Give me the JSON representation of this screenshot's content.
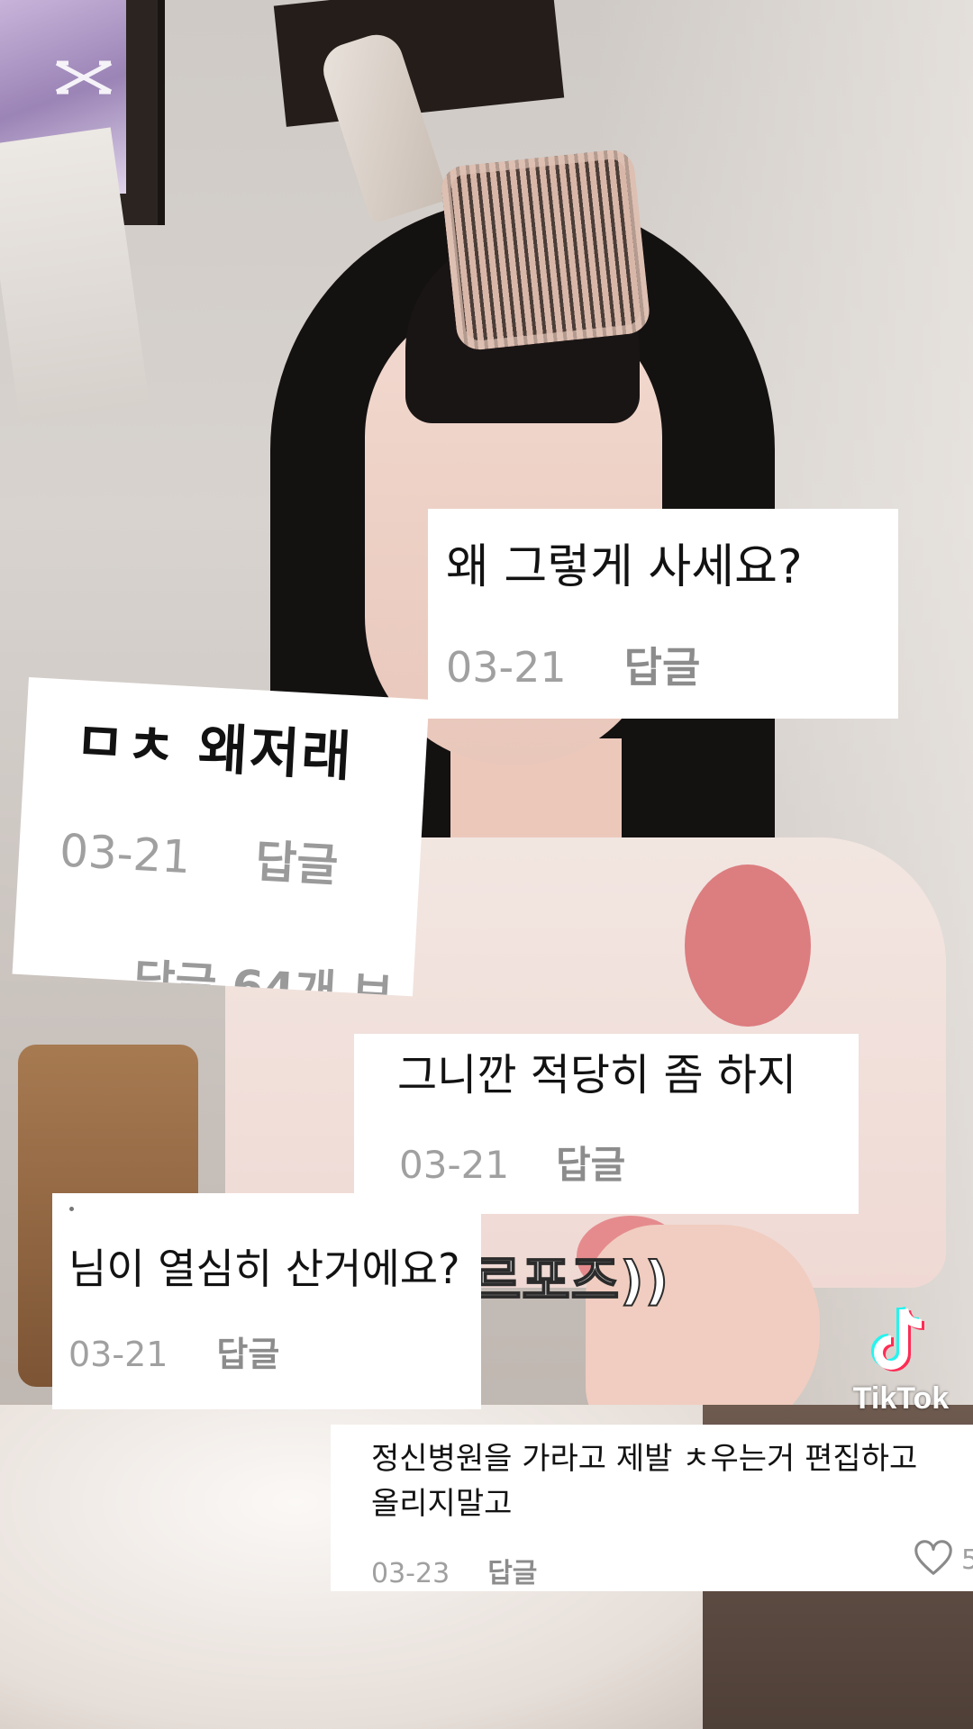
{
  "video": {
    "caption": "르포즈))",
    "watermark_left": "capcut-logo",
    "watermark_right": "TikTok"
  },
  "comments": [
    {
      "text": "왜 그렇게 사세요?",
      "date": "03-21",
      "reply": "답글"
    },
    {
      "text": "ㅁㅊ 왜저래",
      "date": "03-21",
      "reply": "답글",
      "cut_text": "답글 64개 보"
    },
    {
      "text": "그니깐 적당히 좀 하지",
      "date": "03-21",
      "reply": "답글"
    },
    {
      "text": "님이 열심히 산거에요?",
      "date": "03-21",
      "reply": "답글"
    },
    {
      "text_line1": "정신병원을 가라고 제발 ㅊ우는거 편집하고",
      "text_line2": "올리지말고",
      "date": "03-23",
      "reply": "답글",
      "like_count": "5"
    }
  ],
  "colors": {
    "card_bg": "#ffffff",
    "meta_gray": "#a0a0a0",
    "text": "#121212"
  }
}
